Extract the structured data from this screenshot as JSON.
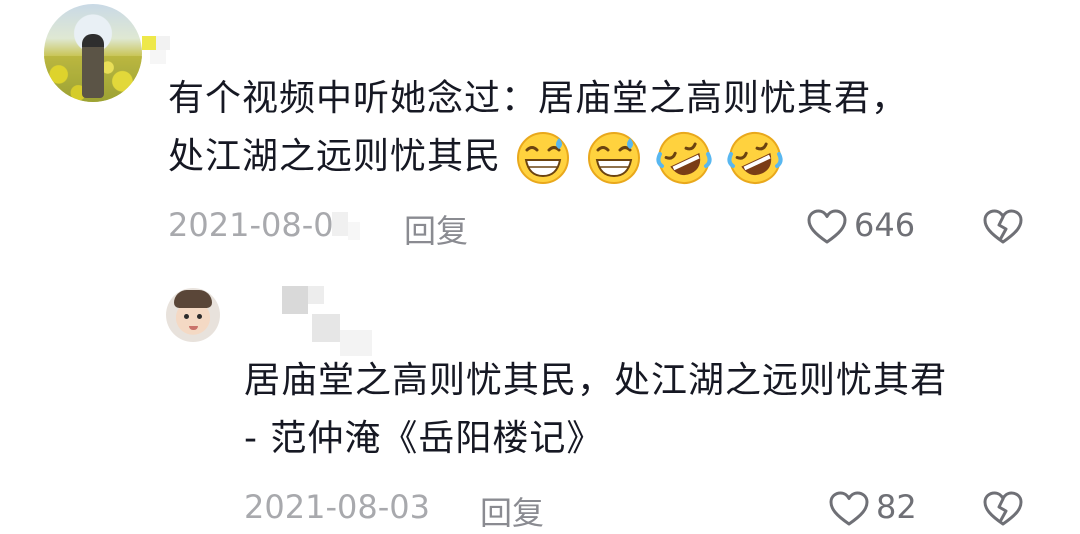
{
  "comments": [
    {
      "text_line1": "有个视频中听她念过：居庙堂之高则忧其君，",
      "text_line2": "处江湖之远则忧其民",
      "emojis": [
        "grin-sweat-icon",
        "grin-sweat-icon",
        "rofl-icon",
        "rofl-icon"
      ],
      "date": "2021-08-0",
      "reply_label": "回复",
      "likes": "646"
    },
    {
      "text_line1": "居庙堂之高则忧其民，处江湖之远则忧其君",
      "text_line2": "- 范仲淹《岳阳楼记》",
      "date": "2021-08-03",
      "reply_label": "回复",
      "likes": "82"
    }
  ],
  "colors": {
    "text": "#161823",
    "meta": "#a8a9ad",
    "icon": "#6f7076"
  }
}
